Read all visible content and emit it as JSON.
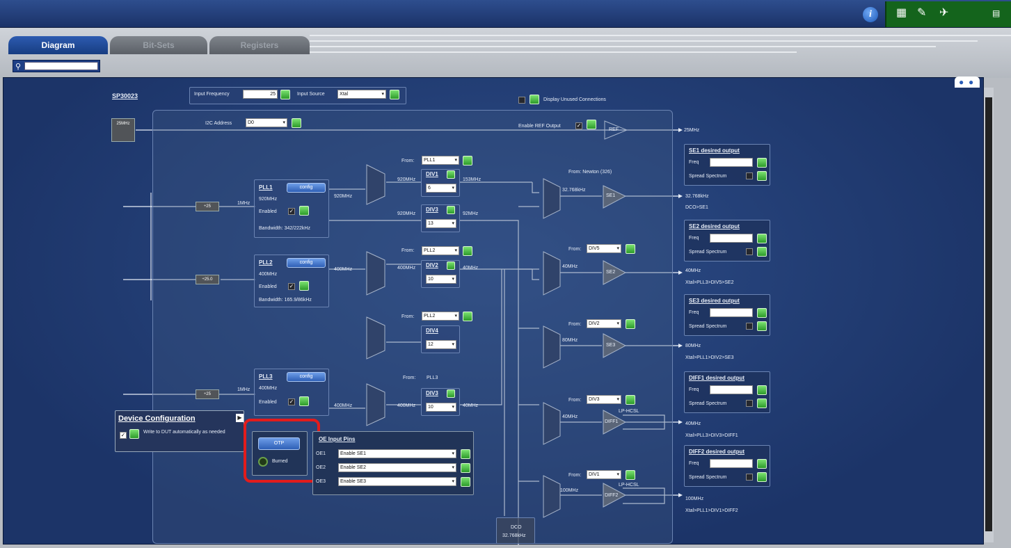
{
  "header": {
    "icons": [
      "info-icon",
      "chip-icon",
      "wand-icon",
      "pin-icon",
      "menu-icon"
    ],
    "accent": "#14641c"
  },
  "tabs": [
    {
      "label": "Diagram",
      "active": true
    },
    {
      "label": "Bit-Sets",
      "active": false
    },
    {
      "label": "Registers",
      "active": false
    }
  ],
  "search": {
    "value": ""
  },
  "device": {
    "name": "SP30023"
  },
  "input_frequency": {
    "label": "Input Frequency",
    "value": "25"
  },
  "input_source": {
    "label": "Input Source",
    "value": "Xtal"
  },
  "display_unused": {
    "label": "Display Unused Connections"
  },
  "i2c_address": {
    "label": "I2C Address",
    "value": "D0"
  },
  "enable_ref": {
    "label": "Enable REF Output"
  },
  "ref": {
    "label": "REF",
    "out": "25MHz"
  },
  "xtal": {
    "label": "25MHz"
  },
  "prediv": [
    {
      "label": "÷25",
      "freq": "1MHz"
    },
    {
      "label": "÷25.0",
      "freq": ""
    },
    {
      "label": "÷25",
      "freq": "1MHz"
    }
  ],
  "plls": [
    {
      "title": "PLL1",
      "config": "config",
      "freq": "920MHz",
      "enabled": "Enabled",
      "bandwidth": "Bandwidth: 342/222kHz",
      "out": "920MHz"
    },
    {
      "title": "PLL2",
      "config": "config",
      "freq": "400MHz",
      "enabled": "Enabled",
      "bandwidth": "Bandwidth: 165.9/86kHz",
      "out": "400MHz"
    },
    {
      "title": "PLL3",
      "config": "config",
      "freq": "400MHz",
      "enabled": "Enabled",
      "bandwidth": "",
      "out": "400MHz"
    }
  ],
  "dividers": [
    {
      "from_label": "From:",
      "from": "PLL1",
      "name": "DIV1",
      "value": "6",
      "in": "920MHz",
      "out": "153MHz"
    },
    {
      "from_label": "",
      "from": "",
      "name": "DIV3",
      "value": "13",
      "in": "920MHz",
      "out": "92MHz"
    },
    {
      "from_label": "From:",
      "from": "PLL2",
      "name": "DIV2",
      "value": "10",
      "in": "400MHz",
      "out": "40MHz"
    },
    {
      "from_label": "From:",
      "from": "PLL2",
      "name": "DIV4",
      "value": "12",
      "in": "",
      "out": ""
    },
    {
      "from_label": "From:",
      "from": "PLL3",
      "name": "DIV3",
      "value": "10",
      "in": "400MHz",
      "out": "40MHz"
    }
  ],
  "outputs": [
    {
      "from_label": "From: Newton (326)",
      "from": "",
      "mux_freq": "32.768kHz",
      "block": "SE1",
      "out": "32.768kHz",
      "path": "DCO>SE1",
      "panel": "SE1 desired output"
    },
    {
      "from_label": "From:",
      "from": "DIV5",
      "mux_freq": "40MHz",
      "block": "SE2",
      "out": "40MHz",
      "path": "Xtal>PLL3>DIV5>SE2",
      "panel": "SE2 desired output"
    },
    {
      "from_label": "From:",
      "from": "DIV2",
      "mux_freq": "80MHz",
      "block": "SE3",
      "out": "80MHz",
      "path": "Xtal>PLL1>DIV2>SE3",
      "panel": "SE3 desired output"
    },
    {
      "from_label": "From:",
      "from": "DIV3",
      "mux_freq": "40MHz",
      "block": "DIFF1",
      "lp": "LP-HCSL",
      "out": "40MHz",
      "path": "Xtal>PLL3>DIV3>DIFF1",
      "panel": "DIFF1 desired output"
    },
    {
      "from_label": "From:",
      "from": "DIV1",
      "mux_freq": "100MHz",
      "block": "DIFF2",
      "lp": "LP-HCSL",
      "out": "100MHz",
      "path": "Xtal>PLL1>DIV1>DIFF2",
      "panel": "DIFF2 desired output"
    }
  ],
  "panel_fields": {
    "freq": "Freq",
    "spread": "Spread Spectrum"
  },
  "dco": {
    "label": "DCO",
    "freq": "32.768kHz"
  },
  "device_config": {
    "title": "Device Configuration",
    "option": "Write to DUT automatically as needed"
  },
  "otp": {
    "button": "OTP",
    "status": "Burned"
  },
  "oe_pins": {
    "title": "OE Input Pins",
    "rows": [
      {
        "pin": "OE1",
        "value": "Enable SE1"
      },
      {
        "pin": "OE2",
        "value": "Enable SE2"
      },
      {
        "pin": "OE3",
        "value": "Enable SE3"
      }
    ]
  }
}
